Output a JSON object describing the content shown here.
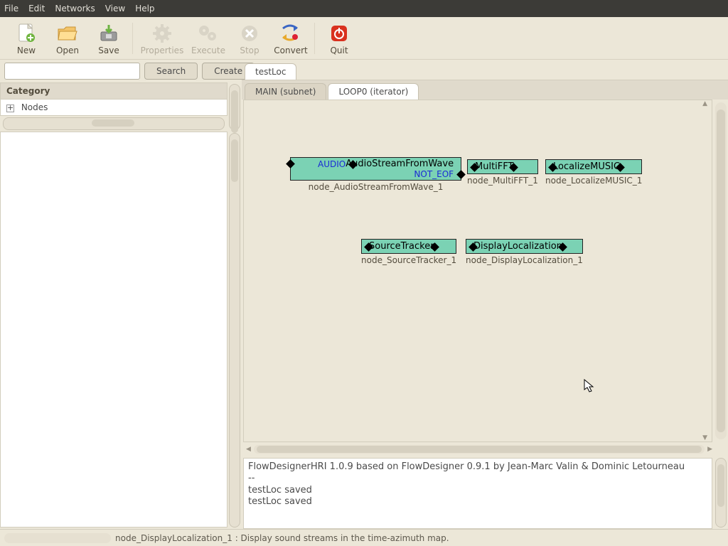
{
  "menubar": [
    "File",
    "Edit",
    "Networks",
    "View",
    "Help"
  ],
  "toolbar": {
    "new": "New",
    "open": "Open",
    "save": "Save",
    "properties": "Properties",
    "execute": "Execute",
    "stop": "Stop",
    "convert": "Convert",
    "quit": "Quit"
  },
  "search": {
    "placeholder": "",
    "btn_search": "Search",
    "btn_create": "Create"
  },
  "category": {
    "header": "Category",
    "root": "Nodes"
  },
  "project_tabs": {
    "active": "testLoc"
  },
  "sub_tabs": {
    "inactive": "MAIN (subnet)",
    "active": "LOOP0 (iterator)"
  },
  "nodes": {
    "audio": {
      "title": "AudioStreamFromWave",
      "out1": "AUDIO",
      "out2": "NOT_EOF",
      "sub": "node_AudioStreamFromWave_1"
    },
    "fft": {
      "title": "MultiFFT",
      "sub": "node_MultiFFT_1"
    },
    "music": {
      "title": "LocalizeMUSIC",
      "sub": "node_LocalizeMUSIC_1"
    },
    "tracker": {
      "title": "SourceTracker",
      "sub": "node_SourceTracker_1"
    },
    "disp": {
      "title": "DisplayLocalization",
      "sub": "node_DisplayLocalization_1"
    }
  },
  "log": {
    "line1": "FlowDesignerHRI 1.0.9 based on FlowDesigner 0.9.1 by Jean-Marc Valin & Dominic Letourneau",
    "line2": "--",
    "line3": "testLoc saved",
    "line4": "testLoc saved"
  },
  "status": "node_DisplayLocalization_1 : Display sound streams in the time-azimuth map."
}
